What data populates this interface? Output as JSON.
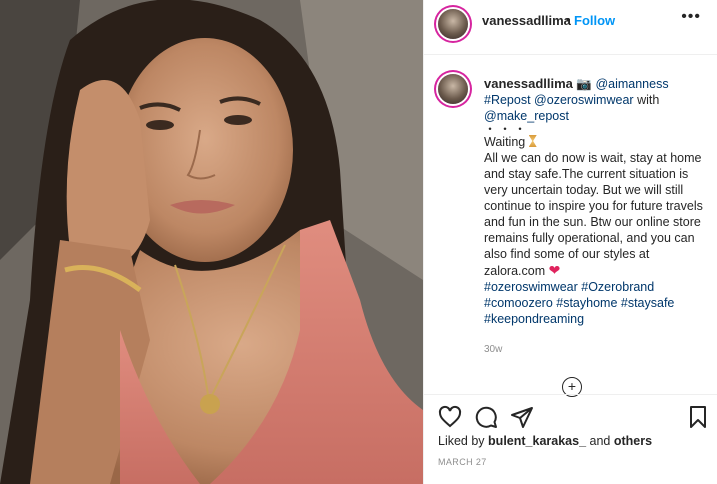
{
  "header": {
    "username": "vanessadllima",
    "separator": "•",
    "follow_label": "Follow",
    "more_label": "•••"
  },
  "caption": {
    "username": "vanessadllima",
    "camera_emoji": "📷",
    "mention_1": "@aimanness",
    "repost_tag": "#Repost",
    "mention_2": "@ozeroswimwear",
    "with_text": "with",
    "mention_3": "@make_repost",
    "dots": "・・・",
    "waiting": "Waiting",
    "body": "All we can do now is wait, stay at home and stay safe.The current situation is very uncertain today. But we will still continue to inspire you for future travels and fun in the sun. Btw our online store remains fully operational, and you can also find some of our styles at zalora.com",
    "heart_emoji": "❤",
    "hashtags": "#ozeroswimwear #Ozerobrand #comoozero #stayhome #staysafe #keepondreaming",
    "age": "30w"
  },
  "load_more": "+",
  "icons": {
    "like": "heart-icon",
    "comment": "comment-icon",
    "share": "share-icon",
    "save": "bookmark-icon"
  },
  "likes": {
    "prefix": "Liked by",
    "user": "bulent_karakas_",
    "and": "and",
    "others": "others"
  },
  "date": "MARCH 27"
}
